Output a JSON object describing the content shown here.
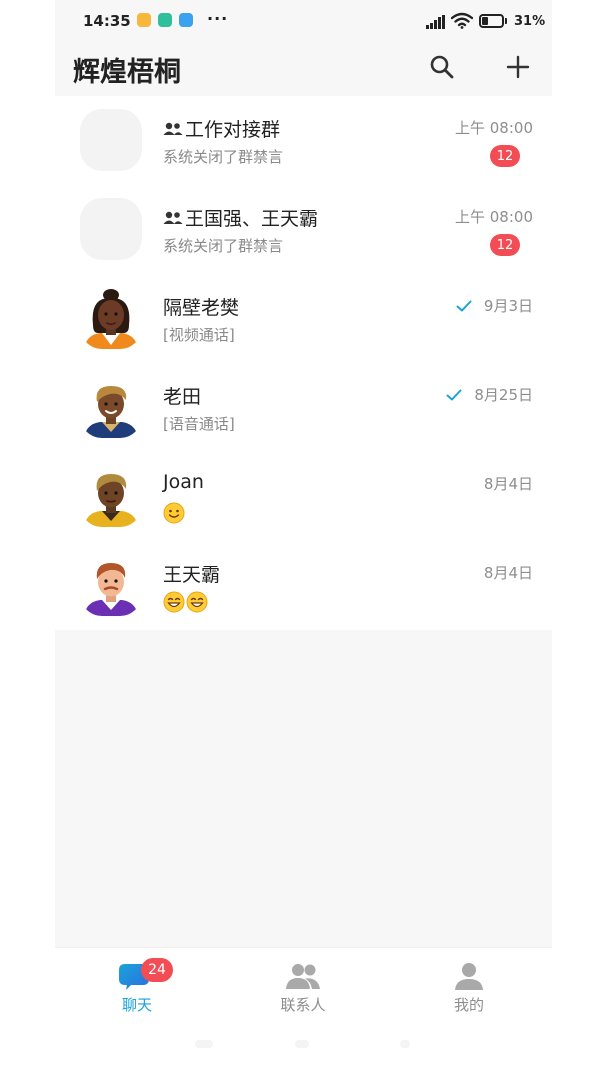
{
  "status_bar": {
    "time": "14:35",
    "battery": "31%",
    "battery_level": 0.31,
    "app_icons": [
      "#f6b73c",
      "#2fbf9a",
      "#3aa2ee"
    ]
  },
  "header": {
    "title": "辉煌梧桐"
  },
  "chats": [
    {
      "name": "工作对接群",
      "group": true,
      "subtitle": "系统关闭了群禁言",
      "time": "上午 08:00",
      "badge": "12",
      "read": false
    },
    {
      "name": "王国强、王天霸",
      "group": true,
      "subtitle": "系统关闭了群禁言",
      "time": "上午 08:00",
      "badge": "12",
      "read": false
    },
    {
      "name": "隔壁老樊",
      "group": false,
      "subtitle": "[视频通话]",
      "time": "9月3日",
      "badge": "",
      "read": true
    },
    {
      "name": "老田",
      "group": false,
      "subtitle": "[语音通话]",
      "time": "8月25日",
      "badge": "",
      "read": true
    },
    {
      "name": "Joan",
      "group": false,
      "subtitle": "",
      "time": "8月4日",
      "badge": "",
      "read": false
    },
    {
      "name": "王天霸",
      "group": false,
      "subtitle": "",
      "time": "8月4日",
      "badge": "",
      "read": false
    }
  ],
  "bottom_nav": {
    "chat_label": "聊天",
    "chat_badge": "24",
    "contacts_label": "联系人",
    "me_label": "我的"
  },
  "colors": {
    "accent": "#1aa3d9",
    "badge": "#f24d54",
    "inactive": "#8e8e8e"
  }
}
